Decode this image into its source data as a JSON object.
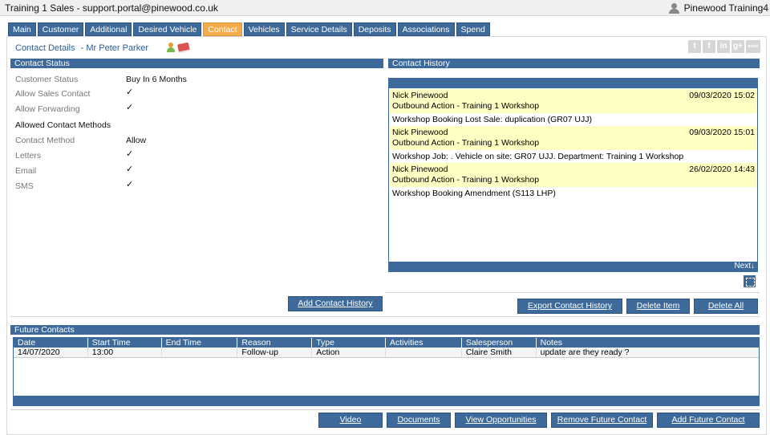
{
  "window": {
    "title": "Training 1 Sales - support.portal@pinewood.co.uk",
    "user": "Pinewood Training4"
  },
  "tabs": [
    {
      "label": "Main"
    },
    {
      "label": "Customer"
    },
    {
      "label": "Additional"
    },
    {
      "label": "Desired Vehicle"
    },
    {
      "label": "Contact",
      "active": true
    },
    {
      "label": "Vehicles"
    },
    {
      "label": "Service Details"
    },
    {
      "label": "Deposits"
    },
    {
      "label": "Associations"
    },
    {
      "label": "Spend"
    }
  ],
  "breadcrumb": {
    "section": "Contact Details",
    "customer": "- Mr Peter Parker"
  },
  "social": [
    "t",
    "f",
    "in",
    "g+",
    "email"
  ],
  "contact_status": {
    "header": "Contact Status",
    "rows": [
      {
        "label": "Customer Status",
        "value": "Buy In 6 Months"
      },
      {
        "label": "Allow Sales Contact",
        "value": "✓"
      },
      {
        "label": "Allow Forwarding",
        "value": "✓"
      },
      {
        "label": "Allowed Contact Methods",
        "value": ""
      },
      {
        "label": "Contact Method",
        "value": "Allow"
      },
      {
        "label": "Letters",
        "value": "✓"
      },
      {
        "label": "Email",
        "value": "✓"
      },
      {
        "label": "SMS",
        "value": "✓"
      }
    ],
    "add_button": "Add Contact History"
  },
  "contact_history": {
    "header": "Contact History",
    "entries": [
      {
        "name": "Nick Pinewood",
        "action": "Outbound Action - Training 1 Workshop",
        "datetime": "09/03/2020 15:02",
        "detail": "Workshop Booking Lost Sale: duplication (GR07 UJJ)"
      },
      {
        "name": "Nick Pinewood",
        "action": "Outbound Action - Training 1 Workshop",
        "datetime": "09/03/2020 15:01",
        "detail": "Workshop Job: . Vehicle on site: GR07 UJJ. Department: Training 1 Workshop"
      },
      {
        "name": "Nick Pinewood",
        "action": "Outbound Action - Training 1 Workshop",
        "datetime": "26/02/2020 14:43",
        "detail": "Workshop Booking Amendment (S113 LHP)"
      }
    ],
    "next_label": "Next↓",
    "buttons": {
      "export": "Export Contact History",
      "delete_item": "Delete Item",
      "delete_all": "Delete All"
    }
  },
  "future_contacts": {
    "header": "Future Contacts",
    "columns": [
      "Date",
      "Start Time",
      "End Time",
      "Reason",
      "Type",
      "Activities",
      "Salesperson",
      "Notes"
    ],
    "rows": [
      [
        "14/07/2020",
        "13:00",
        "",
        "Follow-up",
        "Action",
        "",
        "Claire Smith",
        "update are they ready ?"
      ]
    ]
  },
  "bottom_buttons": {
    "video": "Video",
    "documents": "Documents",
    "view_opportunities": "View Opportunities",
    "remove_future_contact": "Remove Future Contact",
    "add_future_contact": "Add Future Contact"
  }
}
